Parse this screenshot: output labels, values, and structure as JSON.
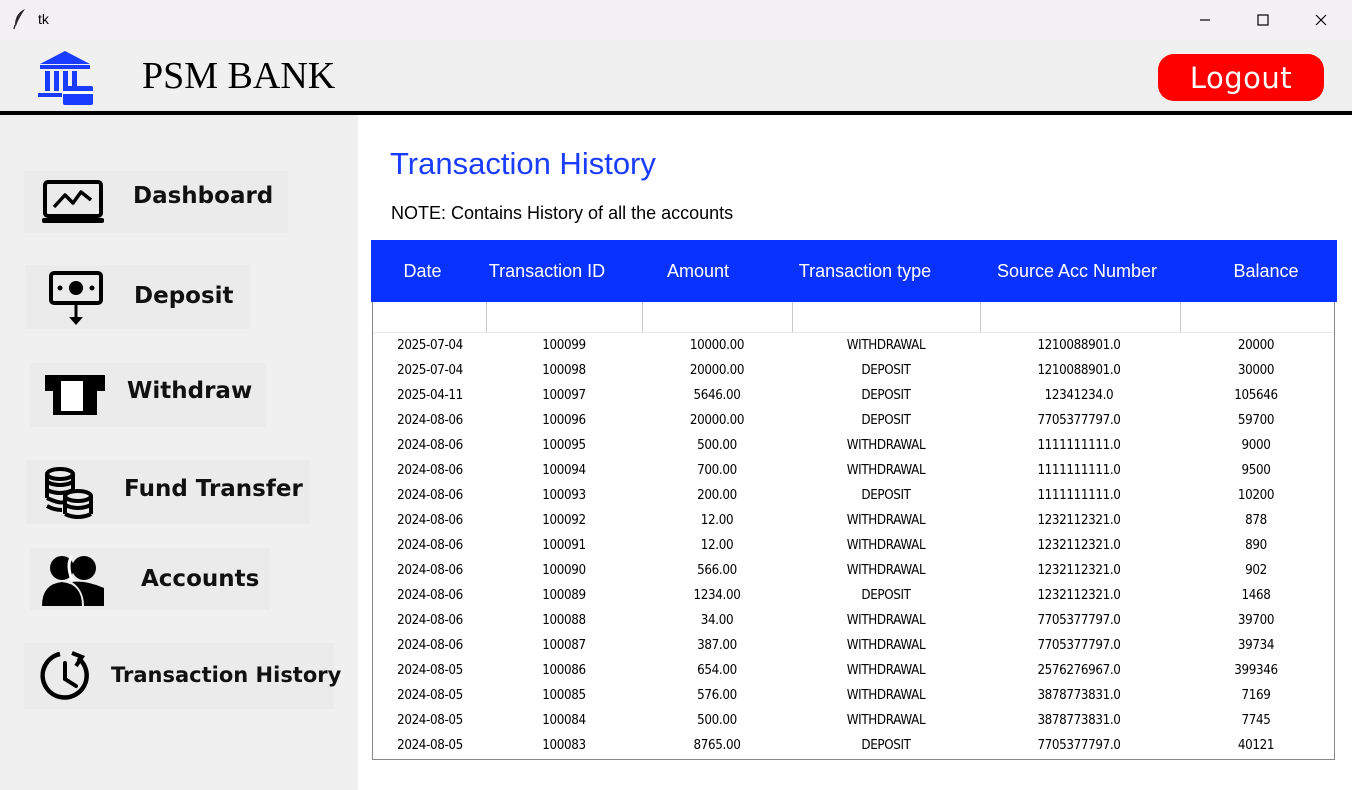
{
  "window": {
    "title": "tk"
  },
  "header": {
    "bank_name": "PSM BANK",
    "logout_label": "Logout"
  },
  "sidebar": {
    "items": [
      {
        "label": "Dashboard",
        "icon": "monitor-chart-icon"
      },
      {
        "label": "Deposit",
        "icon": "cash-deposit-icon"
      },
      {
        "label": "Withdraw",
        "icon": "card-withdraw-icon"
      },
      {
        "label": "Fund Transfer",
        "icon": "coins-stack-icon"
      },
      {
        "label": "Accounts",
        "icon": "users-icon"
      },
      {
        "label": "Transaction History",
        "icon": "clock-history-icon"
      }
    ]
  },
  "main": {
    "title": "Transaction History",
    "note": "NOTE: Contains History of all the accounts",
    "columns": [
      "Date",
      "Transaction ID",
      "Amount",
      "Transaction type",
      "Source Acc Number",
      "Balance"
    ],
    "rows": [
      [
        "2025-07-04",
        "100099",
        "10000.00",
        "WITHDRAWAL",
        "1210088901.0",
        "20000"
      ],
      [
        "2025-07-04",
        "100098",
        "20000.00",
        "DEPOSIT",
        "1210088901.0",
        "30000"
      ],
      [
        "2025-04-11",
        "100097",
        "5646.00",
        "DEPOSIT",
        "12341234.0",
        "105646"
      ],
      [
        "2024-08-06",
        "100096",
        "20000.00",
        "DEPOSIT",
        "7705377797.0",
        "59700"
      ],
      [
        "2024-08-06",
        "100095",
        "500.00",
        "WITHDRAWAL",
        "1111111111.0",
        "9000"
      ],
      [
        "2024-08-06",
        "100094",
        "700.00",
        "WITHDRAWAL",
        "1111111111.0",
        "9500"
      ],
      [
        "2024-08-06",
        "100093",
        "200.00",
        "DEPOSIT",
        "1111111111.0",
        "10200"
      ],
      [
        "2024-08-06",
        "100092",
        "12.00",
        "WITHDRAWAL",
        "1232112321.0",
        "878"
      ],
      [
        "2024-08-06",
        "100091",
        "12.00",
        "WITHDRAWAL",
        "1232112321.0",
        "890"
      ],
      [
        "2024-08-06",
        "100090",
        "566.00",
        "WITHDRAWAL",
        "1232112321.0",
        "902"
      ],
      [
        "2024-08-06",
        "100089",
        "1234.00",
        "DEPOSIT",
        "1232112321.0",
        "1468"
      ],
      [
        "2024-08-06",
        "100088",
        "34.00",
        "WITHDRAWAL",
        "7705377797.0",
        "39700"
      ],
      [
        "2024-08-06",
        "100087",
        "387.00",
        "WITHDRAWAL",
        "7705377797.0",
        "39734"
      ],
      [
        "2024-08-05",
        "100086",
        "654.00",
        "WITHDRAWAL",
        "2576276967.0",
        "399346"
      ],
      [
        "2024-08-05",
        "100085",
        "576.00",
        "WITHDRAWAL",
        "3878773831.0",
        "7169"
      ],
      [
        "2024-08-05",
        "100084",
        "500.00",
        "WITHDRAWAL",
        "3878773831.0",
        "7745"
      ],
      [
        "2024-08-05",
        "100083",
        "8765.00",
        "DEPOSIT",
        "7705377797.0",
        "40121"
      ]
    ]
  },
  "colors": {
    "accent": "#0a32ff",
    "title": "#1a3cff",
    "logout": "#ff0000"
  }
}
